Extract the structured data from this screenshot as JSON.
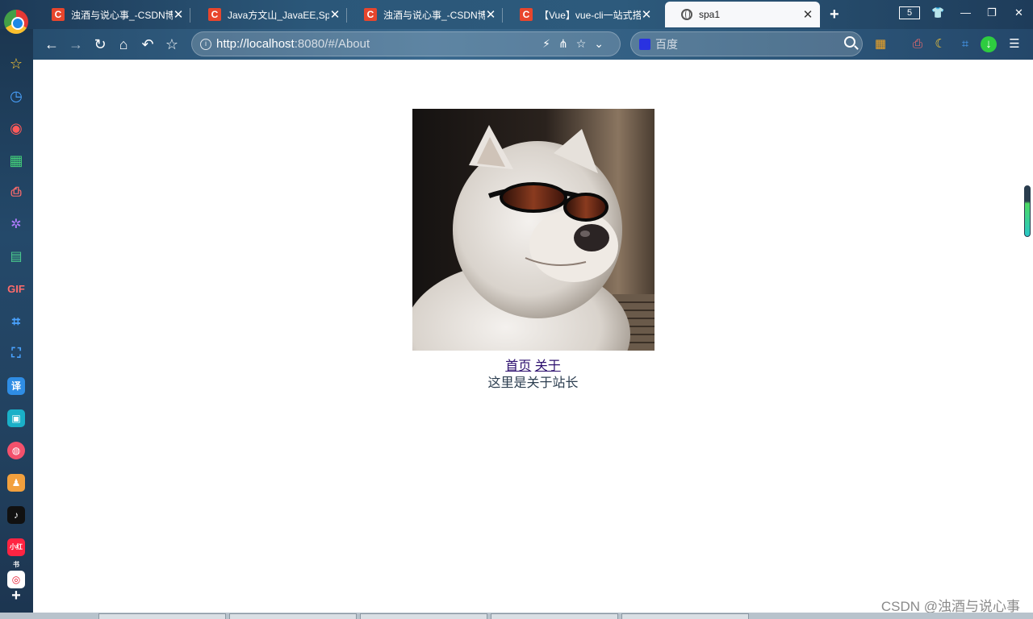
{
  "browser": {
    "tabs": [
      {
        "title": "浊酒与说心事_-CSDN博",
        "icon": "csdn-icon",
        "active": false
      },
      {
        "title": "Java方文山_JavaEE,Spri",
        "icon": "csdn-icon",
        "active": false
      },
      {
        "title": "浊酒与说心事_-CSDN博",
        "icon": "csdn-icon",
        "active": false
      },
      {
        "title": "【Vue】vue-cli一站式搭",
        "icon": "csdn-icon",
        "active": false
      },
      {
        "title": "spa1",
        "icon": "globe-icon",
        "active": true
      }
    ],
    "tab_count": "5",
    "csdn_icon_letter": "C",
    "url_host": "http://localhost",
    "url_rest": ":8080/#/About",
    "search_placeholder": "百度",
    "close_glyph": "✕",
    "new_tab_glyph": "+"
  },
  "page": {
    "image_description_name": "dog-sunglasses-image",
    "nav_home": "首页",
    "nav_about": "关于",
    "about_text": "这里是关于站长"
  },
  "watermark": "CSDN @浊酒与说心事",
  "sidebar": {
    "gif_label": "GIF",
    "translate_label": "译",
    "xiaohongshu_label": "小红书",
    "add_label": "+"
  },
  "colors": {
    "accent_green": "#4cd964",
    "csdn_red": "#e8462d",
    "link_purple": "#2c0f6e"
  }
}
